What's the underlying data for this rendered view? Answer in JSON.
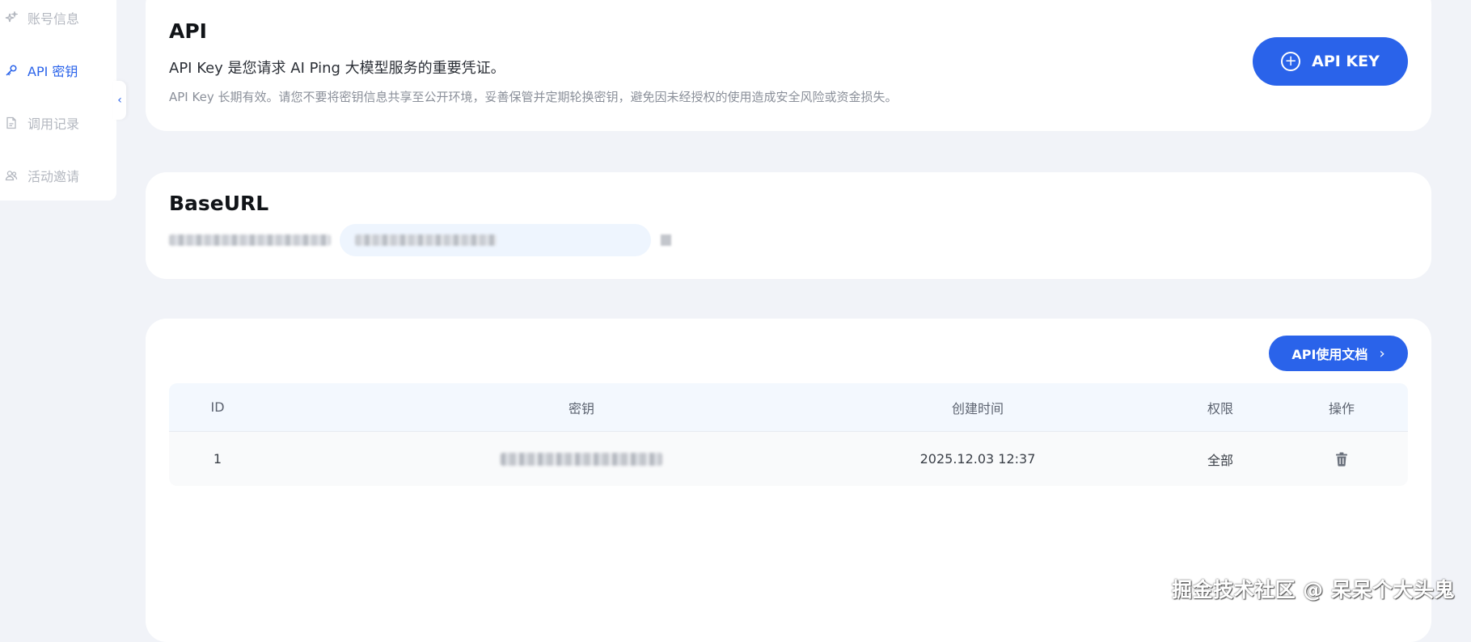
{
  "sidebar": {
    "items": [
      {
        "label": "账号信息",
        "icon": "sparkle-icon",
        "active": false
      },
      {
        "label": "API 密钥",
        "icon": "key-icon",
        "active": true
      },
      {
        "label": "调用记录",
        "icon": "document-icon",
        "active": false
      },
      {
        "label": "活动邀请",
        "icon": "users-icon",
        "active": false
      }
    ],
    "collapse_icon": "‹"
  },
  "api_card": {
    "title": "API",
    "subtitle": "API Key 是您请求 AI Ping 大模型服务的重要凭证。",
    "warning": "API Key 长期有效。请您不要将密钥信息共享至公开环境，妥善保管并定期轮换密钥，避免因未经授权的使用造成安全风险或资金损失。",
    "create_button_label": "API KEY",
    "create_button_icon": "plus-circle-icon"
  },
  "base_card": {
    "title": "BaseURL"
  },
  "keys_card": {
    "docs_button_label": "API使用文档",
    "docs_button_icon": "›",
    "columns": {
      "id": "ID",
      "key": "密钥",
      "created": "创建时间",
      "permission": "权限",
      "actions": "操作"
    },
    "rows": [
      {
        "id": "1",
        "created": "2025.12.03 12:37",
        "permission": "全部",
        "action_icon": "trash-icon"
      }
    ]
  },
  "watermark": "掘金技术社区 @ 呆呆个大头鬼",
  "colors": {
    "accent": "#2a63ea",
    "background": "#f1f3f8",
    "muted": "#b4b8c0"
  }
}
